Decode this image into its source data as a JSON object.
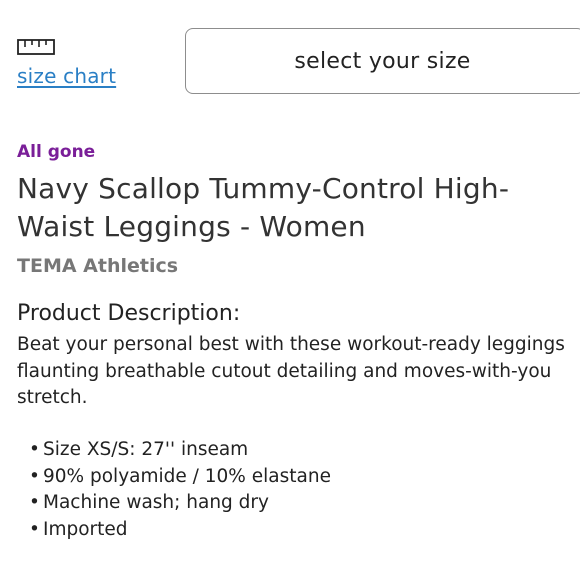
{
  "size_chart": {
    "icon": "ruler-icon",
    "label": "size chart"
  },
  "size_select": {
    "label": "select your size"
  },
  "product": {
    "status": "All gone",
    "title": "Navy Scallop Tummy-Control High-Waist Leggings - Women",
    "brand": "TEMA Athletics"
  },
  "description": {
    "heading": "Product Description:",
    "body": "Beat your personal best with these workout-ready leggings flaunting breathable cutout detailing and moves-with-you stretch.",
    "features": [
      "Size XS/S: 27'' inseam",
      "90% polyamide / 10% elastane",
      "Machine wash; hang dry",
      "Imported"
    ]
  },
  "colors": {
    "link": "#2a7fc5",
    "status": "#7a1e98",
    "brand": "#777777",
    "text": "#333333"
  }
}
